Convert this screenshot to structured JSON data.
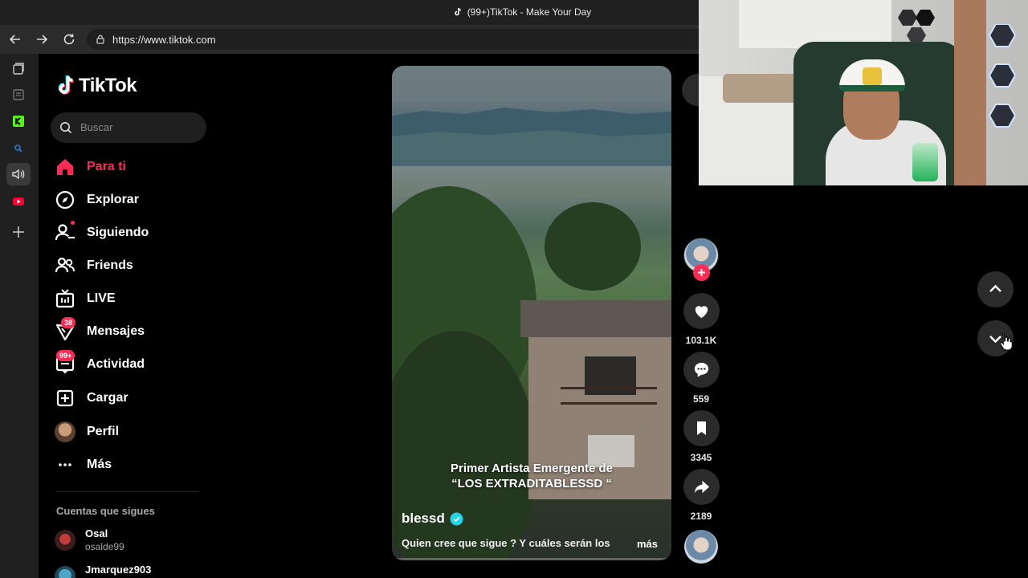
{
  "browser": {
    "tab_title": "(99+)TikTok - Make Your Day",
    "url": "https://www.tiktok.com"
  },
  "app": {
    "brand": "TikTok",
    "search_placeholder": "Buscar",
    "nav": [
      {
        "label": "Para ti",
        "icon": "home-icon",
        "active": true
      },
      {
        "label": "Explorar",
        "icon": "compass-icon"
      },
      {
        "label": "Siguiendo",
        "icon": "following-icon"
      },
      {
        "label": "Friends",
        "icon": "friends-icon"
      },
      {
        "label": "LIVE",
        "icon": "live-icon"
      },
      {
        "label": "Mensajes",
        "icon": "messages-icon",
        "badge": "38"
      },
      {
        "label": "Actividad",
        "icon": "activity-icon",
        "badge": "99+"
      },
      {
        "label": "Cargar",
        "icon": "upload-icon"
      },
      {
        "label": "Perfil",
        "icon": "profile-avatar"
      },
      {
        "label": "Más",
        "icon": "more-icon"
      }
    ],
    "following_heading": "Cuentas que sigues",
    "following": [
      {
        "name": "Osal",
        "username": "osalde99"
      },
      {
        "name": "Jmarquez903",
        "username": ""
      }
    ]
  },
  "video": {
    "caption_line1": "Primer Artista Emergente de",
    "caption_line2": "“LOS EXTRADITABLESSD “",
    "author": "blessd",
    "description": "Quien cree que sigue ?  Y cuáles serán los",
    "more_label": "más"
  },
  "actions": {
    "likes": "103.1K",
    "comments": "559",
    "saves": "3345",
    "shares": "2189"
  },
  "colors": {
    "accent": "#fe2c55",
    "background": "#000000",
    "surface": "#2b2b2b",
    "verified": "#20d5ec"
  }
}
